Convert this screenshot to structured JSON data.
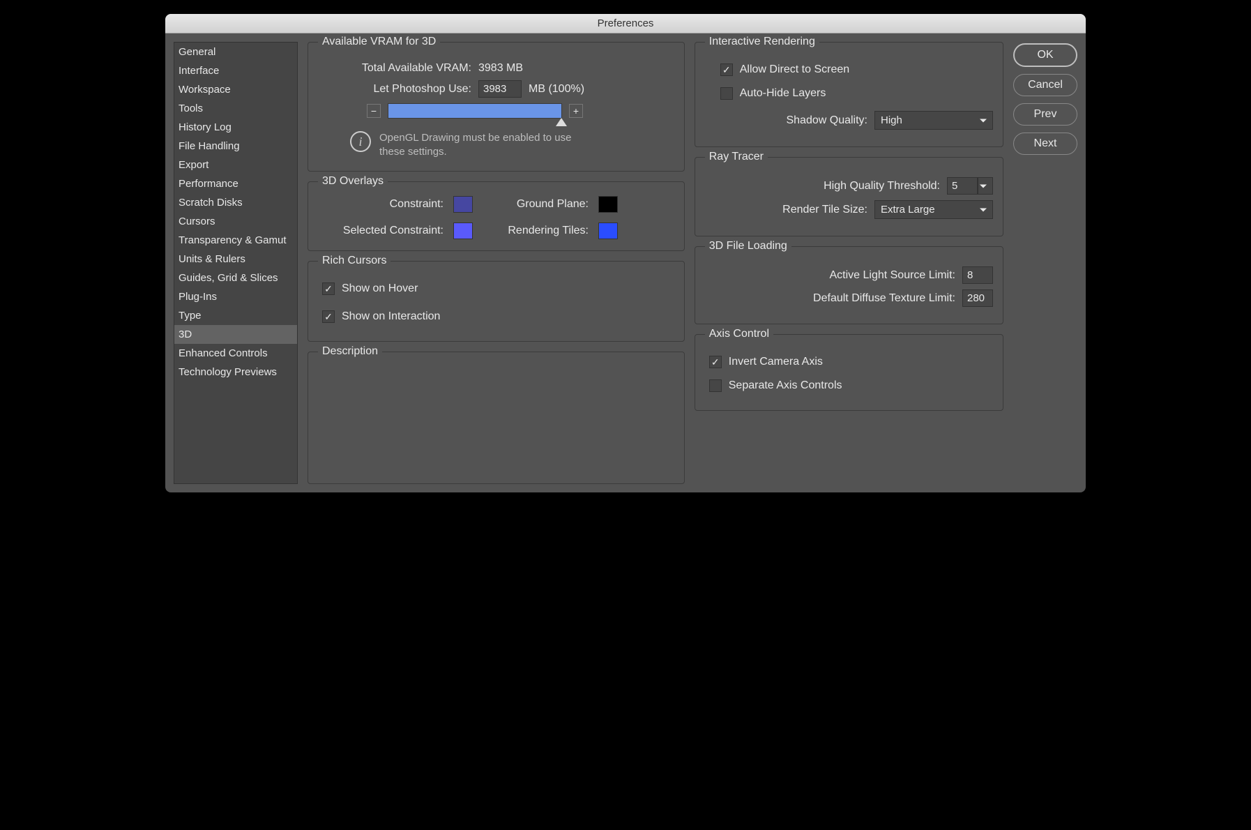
{
  "window": {
    "title": "Preferences"
  },
  "sidebar": {
    "items": [
      "General",
      "Interface",
      "Workspace",
      "Tools",
      "History Log",
      "File Handling",
      "Export",
      "Performance",
      "Scratch Disks",
      "Cursors",
      "Transparency & Gamut",
      "Units & Rulers",
      "Guides, Grid & Slices",
      "Plug-Ins",
      "Type",
      "3D",
      "Enhanced Controls",
      "Technology Previews"
    ],
    "selected": "3D"
  },
  "vram": {
    "group_title": "Available VRAM for 3D",
    "total_label": "Total Available VRAM:",
    "total_value": "3983 MB",
    "use_label": "Let Photoshop Use:",
    "use_value": "3983",
    "use_unit": "MB (100%)",
    "info_text": "OpenGL Drawing must be enabled to use these settings."
  },
  "overlays": {
    "group_title": "3D Overlays",
    "constraint_label": "Constraint:",
    "constraint_color": "#4647a1",
    "ground_label": "Ground Plane:",
    "ground_color": "#000000",
    "selected_constraint_label": "Selected Constraint:",
    "selected_constraint_color": "#5a5afc",
    "rendering_tiles_label": "Rendering Tiles:",
    "rendering_tiles_color": "#2a4dff"
  },
  "rich_cursors": {
    "group_title": "Rich Cursors",
    "hover_label": "Show on Hover",
    "hover_checked": true,
    "interaction_label": "Show on Interaction",
    "interaction_checked": true
  },
  "interactive_rendering": {
    "group_title": "Interactive Rendering",
    "allow_direct_label": "Allow Direct to Screen",
    "allow_direct_checked": true,
    "auto_hide_label": "Auto-Hide Layers",
    "auto_hide_checked": false,
    "shadow_quality_label": "Shadow Quality:",
    "shadow_quality_value": "High"
  },
  "ray_tracer": {
    "group_title": "Ray Tracer",
    "hq_threshold_label": "High Quality Threshold:",
    "hq_threshold_value": "5",
    "tile_size_label": "Render Tile Size:",
    "tile_size_value": "Extra Large"
  },
  "file_loading": {
    "group_title": "3D File Loading",
    "light_limit_label": "Active Light Source Limit:",
    "light_limit_value": "8",
    "texture_limit_label": "Default Diffuse Texture Limit:",
    "texture_limit_value": "280"
  },
  "axis_control": {
    "group_title": "Axis Control",
    "invert_label": "Invert Camera Axis",
    "invert_checked": true,
    "separate_label": "Separate Axis Controls",
    "separate_checked": false
  },
  "description": {
    "group_title": "Description"
  },
  "buttons": {
    "ok": "OK",
    "cancel": "Cancel",
    "prev": "Prev",
    "next": "Next"
  }
}
